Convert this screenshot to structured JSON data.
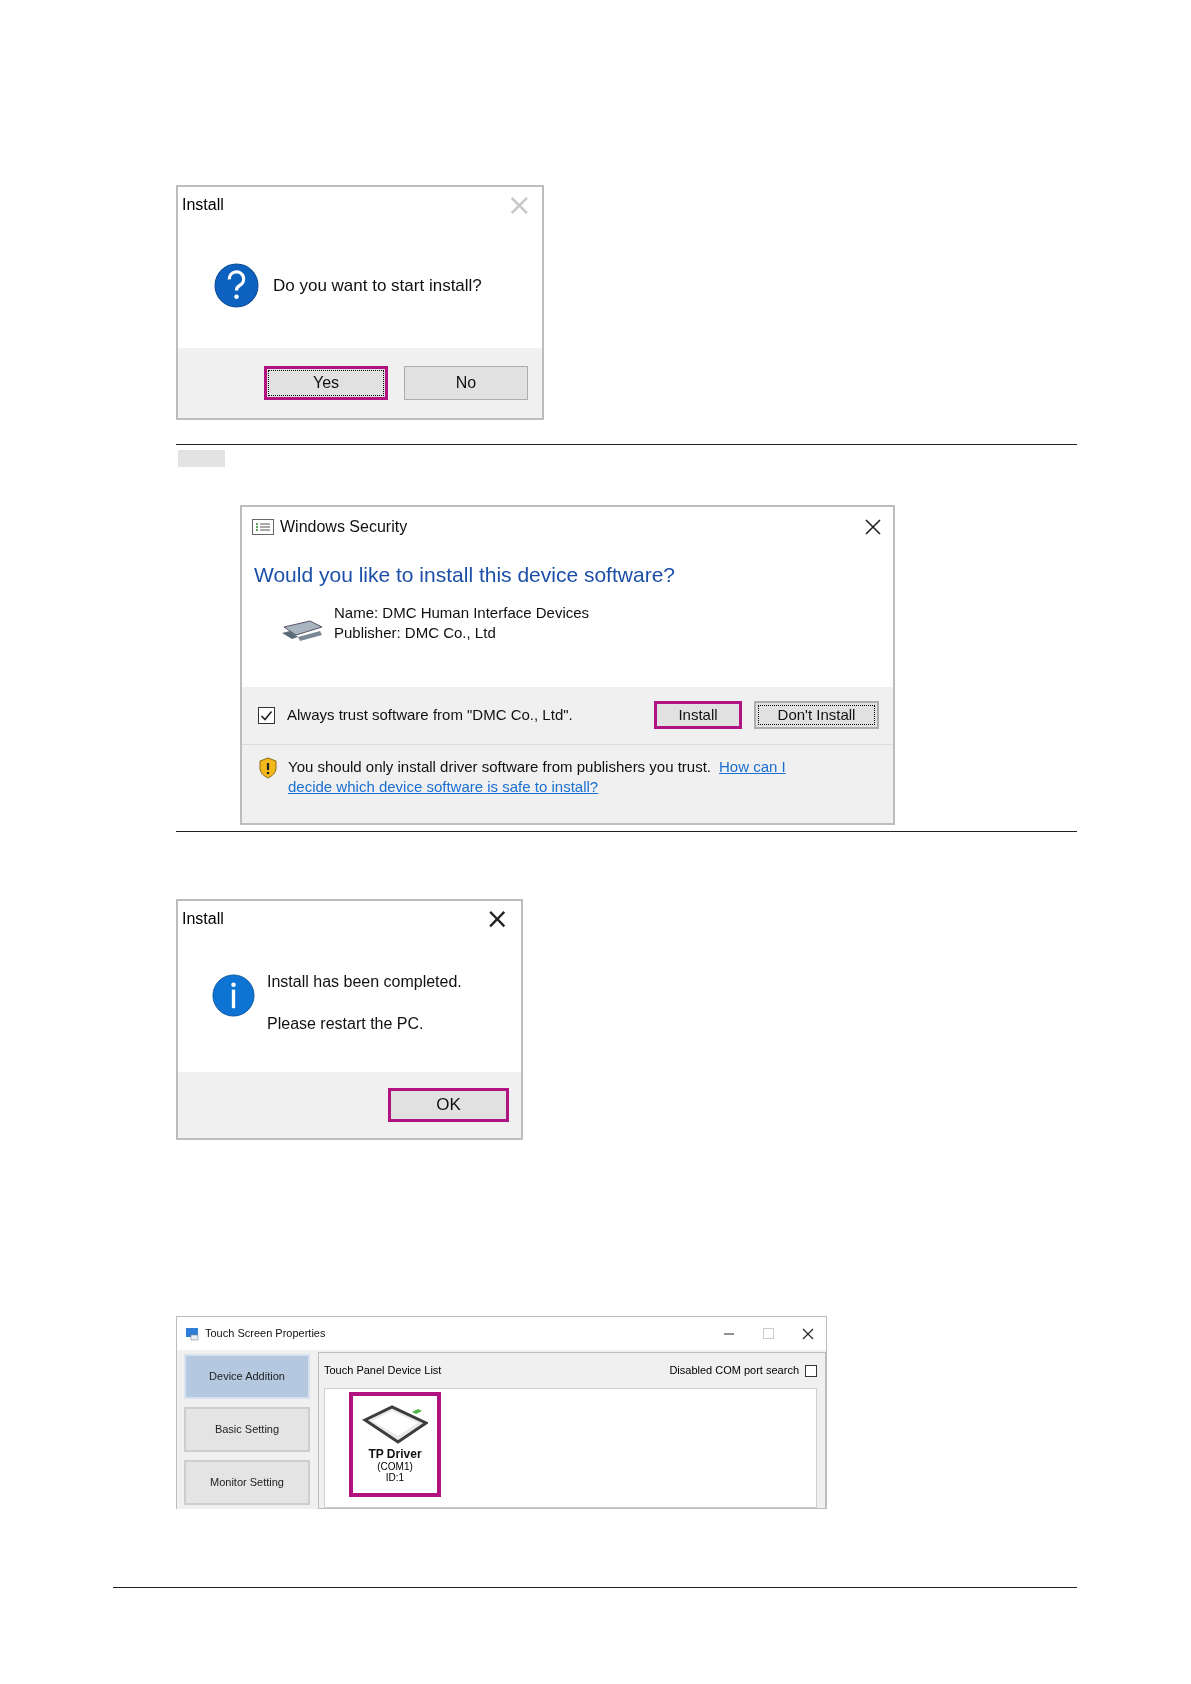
{
  "install_prompt": {
    "title": "Install",
    "close": "×",
    "close_disabled": true,
    "message": "Do you want to start install?",
    "buttons": [
      {
        "label": "Yes",
        "highlighted": true,
        "focused": true
      },
      {
        "label": "No",
        "highlighted": false,
        "focused": false
      }
    ]
  },
  "security_dialog": {
    "title": "Windows Security",
    "heading": "Would you like to install this device software?",
    "name_line": "Name: DMC Human Interface Devices",
    "publisher_line": "Publisher: DMC Co., Ltd",
    "trust_checkbox": {
      "label": "Always trust software from \"DMC Co., Ltd\".",
      "checked": true
    },
    "buttons": [
      {
        "label": "Install",
        "highlighted": true,
        "focused": false
      },
      {
        "label": "Don't Install",
        "highlighted": false,
        "focused": true
      }
    ],
    "warning": "You should only install driver software from publishers you trust.",
    "link_lines": [
      "How can I",
      "decide which device software is safe to install?"
    ]
  },
  "install_complete": {
    "title": "Install",
    "close": "×",
    "close_disabled": false,
    "messages": [
      "Install has been completed.",
      "Please restart the PC."
    ],
    "buttons": [
      {
        "label": "OK",
        "highlighted": true,
        "focused": false
      }
    ]
  },
  "touch_screen": {
    "title": "Touch Screen Properties",
    "tabs": [
      {
        "label": "Device Addition",
        "selected": true
      },
      {
        "label": "Basic Setting",
        "selected": false
      },
      {
        "label": "Monitor Setting",
        "selected": false
      }
    ],
    "list_title": "Touch Panel Device List",
    "com_search": {
      "label": "Disabled COM port search",
      "checked": false
    },
    "devices": [
      {
        "name": "TP Driver",
        "port": "(COM1)",
        "id": "ID:1",
        "highlighted": true
      }
    ]
  }
}
